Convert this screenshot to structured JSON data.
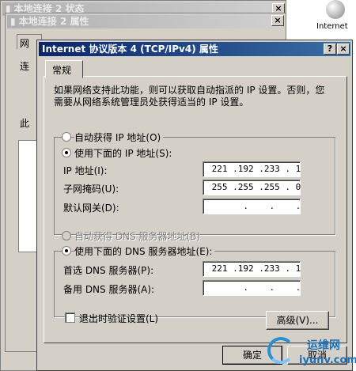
{
  "back_window": {
    "title": "本地连接 2 状态",
    "close_glyph": "×"
  },
  "mid_window": {
    "title": "本地连接 2 属性",
    "close_glyph": "×",
    "tab_fragment": "网",
    "label_fragment": "连",
    "label_fragment2": "此"
  },
  "desktop_icon": {
    "label": "Internet"
  },
  "dialog": {
    "title": "Internet 协议版本 4 (TCP/IPv4) 属性",
    "help_glyph": "?",
    "close_glyph": "×",
    "tab": "常规",
    "description": "如果网络支持此功能，则可以获取自动指派的 IP 设置。否则，您需要从网络系统管理员处获得适当的 IP 设置。",
    "ip": {
      "auto_label": "自动获得 IP 地址(O)",
      "manual_label": "使用下面的 IP 地址(S):",
      "selected": "manual",
      "address_label": "IP 地址(I):",
      "address_value": " 221 .192 .233 . 1",
      "subnet_label": "子网掩码(U):",
      "subnet_value": " 255 .255 .255 . 0",
      "gateway_label": "默认网关(D):",
      "gateway_value": "       .    .    ."
    },
    "dns": {
      "auto_label": "自动获得 DNS 服务器地址(B)",
      "manual_label": "使用下面的 DNS 服务器地址(E):",
      "selected": "manual",
      "preferred_label": "首选 DNS 服务器(P):",
      "preferred_value": " 221 .192 .233 . 1",
      "alternate_label": "备用 DNS 服务器(A):",
      "alternate_value": "       .    .    ."
    },
    "validate_label": "退出时验证设置(L)",
    "validate_checked": false,
    "advanced_button": "高级(V)...",
    "ok_button": "确定",
    "cancel_button": "取消"
  },
  "watermark": {
    "text_top": "运维网",
    "text_bottom": "iyunv.com"
  }
}
